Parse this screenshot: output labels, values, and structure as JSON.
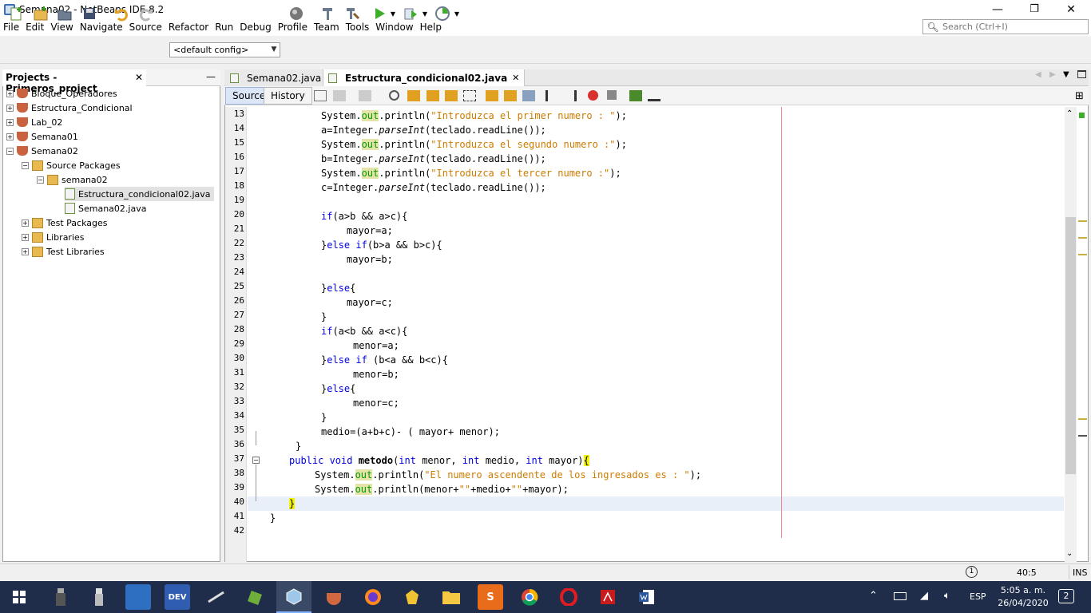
{
  "window": {
    "title": "Semana02 - NetBeans IDE 8.2",
    "minimize": "—",
    "maximize": "❐",
    "close": "✕"
  },
  "menu": [
    "File",
    "Edit",
    "View",
    "Navigate",
    "Source",
    "Refactor",
    "Run",
    "Debug",
    "Profile",
    "Team",
    "Tools",
    "Window",
    "Help"
  ],
  "search": {
    "placeholder": "Search (Ctrl+I)"
  },
  "toolbar": {
    "config": "<default config>"
  },
  "projects": {
    "title": "Projects - Primeros_project",
    "close": "✕",
    "minimize": "—",
    "items": [
      {
        "label": "Bloque_Operadores",
        "toggle": "+"
      },
      {
        "label": "Estructura_Condicional",
        "toggle": "+"
      },
      {
        "label": "Lab_02",
        "toggle": "+"
      },
      {
        "label": "Semana01",
        "toggle": "+"
      },
      {
        "label": "Semana02",
        "toggle": "−"
      },
      {
        "label": "Source Packages",
        "toggle": "−"
      },
      {
        "label": "semana02",
        "toggle": "−"
      },
      {
        "label": "Estructura_condicional02.java"
      },
      {
        "label": "Semana02.java"
      },
      {
        "label": "Test Packages",
        "toggle": "+"
      },
      {
        "label": "Libraries",
        "toggle": "+"
      },
      {
        "label": "Test Libraries",
        "toggle": "+"
      }
    ]
  },
  "editor": {
    "tabs": [
      {
        "label": "Semana02.java",
        "close": "✕"
      },
      {
        "label": "Estructura_condicional02.java",
        "close": "✕"
      }
    ],
    "source_label": "Source",
    "history_label": "History",
    "line_numbers": [
      "13",
      "14",
      "15",
      "16",
      "17",
      "18",
      "19",
      "20",
      "21",
      "22",
      "23",
      "24",
      "25",
      "26",
      "27",
      "28",
      "29",
      "30",
      "31",
      "32",
      "33",
      "34",
      "35",
      "36",
      "37",
      "38",
      "39",
      "40",
      "41",
      "42"
    ],
    "lines": {
      "l13": {
        "a": "System.",
        "b": "out",
        "c": ".println(",
        "d": "\"Introduzca el primer numero : \"",
        "e": ");"
      },
      "l14": {
        "a": "a=Integer.",
        "b": "parseInt",
        "c": "(teclado.readLine());"
      },
      "l15": {
        "a": "System.",
        "b": "out",
        "c": ".println(",
        "d": "\"Introduzca el segundo numero :\"",
        "e": ");"
      },
      "l16": {
        "a": "b=Integer.",
        "b": "parseInt",
        "c": "(teclado.readLine());"
      },
      "l17": {
        "a": "System.",
        "b": "out",
        "c": ".println(",
        "d": "\"Introduzca el tercer numero :\"",
        "e": ");"
      },
      "l18": {
        "a": "c=Integer.",
        "b": "parseInt",
        "c": "(teclado.readLine());"
      },
      "l20": {
        "a": "if",
        "b": "(a>b && a>c){"
      },
      "l21": {
        "a": "mayor=a;"
      },
      "l22": {
        "a": "}",
        "b": "else if",
        "c": "(b>a && b>c){"
      },
      "l23": {
        "a": "mayor=b;"
      },
      "l25": {
        "a": "}",
        "b": "else",
        "c": "{"
      },
      "l26": {
        "a": "mayor=c;"
      },
      "l27": {
        "a": "}"
      },
      "l28": {
        "a": "if",
        "b": "(a<b && a<c){"
      },
      "l29": {
        "a": "menor=a;"
      },
      "l30": {
        "a": "}",
        "b": "else if",
        "c": " (b<a && b<c){"
      },
      "l31": {
        "a": "menor=b;"
      },
      "l32": {
        "a": "}",
        "b": "else",
        "c": "{"
      },
      "l33": {
        "a": "menor=c;"
      },
      "l34": {
        "a": "}"
      },
      "l35": {
        "a": "medio=(a+b+c)- ( mayor+ menor);"
      },
      "l36": {
        "a": "}"
      },
      "l37": {
        "a": "public void ",
        "b": "metodo",
        "c": "(",
        "d": "int",
        "e": " menor, ",
        "f": "int",
        "g": " medio, ",
        "h": "int",
        "i": " mayor)",
        "j": "{"
      },
      "l38": {
        "a": "System.",
        "b": "out",
        "c": ".println(",
        "d": "\"El numero ascendente de los ingresados es : \"",
        "e": ");"
      },
      "l39": {
        "a": "System.",
        "b": "out",
        "c": ".println(menor+",
        "d": "\"\"",
        "e": "+medio+",
        "f": "\"\"",
        "g": "+mayor);"
      },
      "l40": {
        "a": "}"
      },
      "l41": {
        "a": "}"
      }
    }
  },
  "status": {
    "position": "40:5",
    "mode": "INS",
    "notifications": "1"
  },
  "taskbar": {
    "apps": [
      "DEV",
      "S"
    ],
    "lang": "ESP",
    "time": "5:05 a. m.",
    "date": "26/04/2020",
    "notif": "2"
  },
  "colors": {
    "keyword": "#0000e6",
    "string": "#ce7b00",
    "field": "#009900",
    "taskbar": "#1f2d4a"
  }
}
